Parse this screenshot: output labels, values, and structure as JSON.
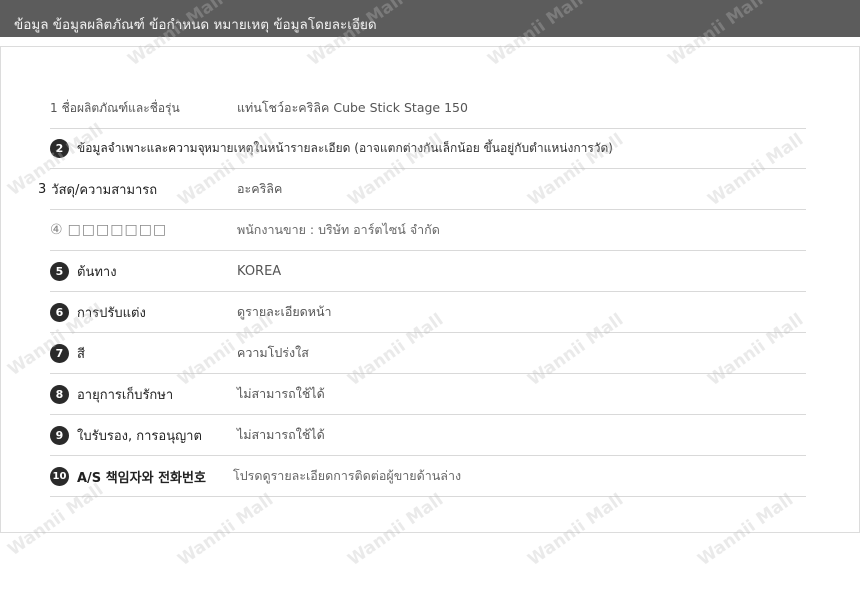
{
  "header": {
    "title": "ข้อมูล ข้อมูลผลิตภัณฑ์ ข้อกำหนด หมายเหตุ ข้อมูลโดยละเอียด"
  },
  "watermark_text": "Wannii Mall",
  "rows": [
    {
      "marker": "1",
      "label": "ชื่อผลิตภัณฑ์และชื่อรุ่น",
      "value": "แท่นโชว์อะคริลิค Cube Stick Stage 150"
    },
    {
      "marker": "2",
      "label": "ข้อมูลจำเพาะและความจุ",
      "value": "หมายเหตุในหน้ารายละเอียด (อาจแตกต่างกันเล็กน้อย ขึ้นอยู่กับตำแหน่งการวัด)"
    },
    {
      "marker": "3",
      "label": "วัสดุ/ความสามารถ",
      "value": "อะคริลิค"
    },
    {
      "marker": "④",
      "label": "□□□□□□□",
      "value": "พนักงานขาย : บริษัท อาร์ตไซน์ จำกัด"
    },
    {
      "marker": "5",
      "label": "ต้นทาง",
      "value": "KOREA"
    },
    {
      "marker": "6",
      "label": "การปรับแต่ง",
      "value": "ดูรายละเอียดหน้า"
    },
    {
      "marker": "7",
      "label": "สี",
      "value": "ความโปร่งใส"
    },
    {
      "marker": "8",
      "label": "อายุการเก็บรักษา",
      "value": "ไม่สามารถใช้ได้"
    },
    {
      "marker": "9",
      "label": "ใบรับรอง, การอนุญาต",
      "value": "ไม่สามารถใช้ได้"
    },
    {
      "marker": "10",
      "label": "A/S 책임자와 전화번호",
      "value": "โปรดดูรายละเอียดการติดต่อผู้ขายด้านล่าง"
    }
  ]
}
